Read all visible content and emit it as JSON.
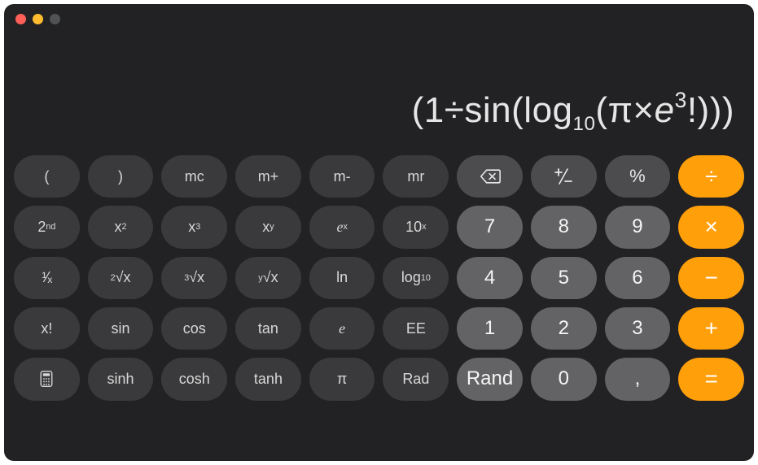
{
  "display": {
    "expression_html": "(1÷sin(log<sub>10</sub>(π×<span class='ital'>e</span><span class='sup'>3</span>!)))"
  },
  "rows": [
    [
      {
        "id": "lparen",
        "label": "(",
        "cls": "btn-sci"
      },
      {
        "id": "rparen",
        "label": ")",
        "cls": "btn-sci"
      },
      {
        "id": "mc",
        "label": "mc",
        "cls": "btn-sci"
      },
      {
        "id": "mplus",
        "label": "m+",
        "cls": "btn-sci"
      },
      {
        "id": "mminus",
        "label": "m-",
        "cls": "btn-sci"
      },
      {
        "id": "mr",
        "label": "mr",
        "cls": "btn-sci"
      },
      {
        "id": "delete",
        "label": "__DELETE__",
        "cls": "btn-func"
      },
      {
        "id": "plusminus",
        "label": "__PLUSMINUS__",
        "cls": "btn-func"
      },
      {
        "id": "percent",
        "label": "%",
        "cls": "btn-func"
      },
      {
        "id": "divide",
        "label": "÷",
        "cls": "btn-op"
      }
    ],
    [
      {
        "id": "second",
        "label": "2<sup>nd</sup>",
        "cls": "btn-sci"
      },
      {
        "id": "x-squared",
        "label": "x<sup>2</sup>",
        "cls": "btn-sci"
      },
      {
        "id": "x-cubed",
        "label": "x<sup>3</sup>",
        "cls": "btn-sci"
      },
      {
        "id": "x-power-y",
        "label": "x<sup>y</sup>",
        "cls": "btn-sci"
      },
      {
        "id": "e-power-x",
        "label": "<span class='ital'>e</span><sup>x</sup>",
        "cls": "btn-sci"
      },
      {
        "id": "ten-power-x",
        "label": "10<sup>x</sup>",
        "cls": "btn-sci"
      },
      {
        "id": "seven",
        "label": "7",
        "cls": "btn-num"
      },
      {
        "id": "eight",
        "label": "8",
        "cls": "btn-num"
      },
      {
        "id": "nine",
        "label": "9",
        "cls": "btn-num"
      },
      {
        "id": "multiply",
        "label": "×",
        "cls": "btn-op"
      }
    ],
    [
      {
        "id": "reciprocal",
        "label": "<span class='slash'>¹⁄ₓ</span>",
        "cls": "btn-sci"
      },
      {
        "id": "sqrt",
        "label": "<sup>2</sup>√x",
        "cls": "btn-sci"
      },
      {
        "id": "cbrt",
        "label": "<sup>3</sup>√x",
        "cls": "btn-sci"
      },
      {
        "id": "yroot",
        "label": "<sup>y</sup>√x",
        "cls": "btn-sci"
      },
      {
        "id": "ln",
        "label": "ln",
        "cls": "btn-sci"
      },
      {
        "id": "log10",
        "label": "log<sub>10</sub>",
        "cls": "btn-sci"
      },
      {
        "id": "four",
        "label": "4",
        "cls": "btn-num"
      },
      {
        "id": "five",
        "label": "5",
        "cls": "btn-num"
      },
      {
        "id": "six",
        "label": "6",
        "cls": "btn-num"
      },
      {
        "id": "subtract",
        "label": "−",
        "cls": "btn-op"
      }
    ],
    [
      {
        "id": "factorial",
        "label": "x!",
        "cls": "btn-sci"
      },
      {
        "id": "sin",
        "label": "sin",
        "cls": "btn-sci"
      },
      {
        "id": "cos",
        "label": "cos",
        "cls": "btn-sci"
      },
      {
        "id": "tan",
        "label": "tan",
        "cls": "btn-sci"
      },
      {
        "id": "e-constant",
        "label": "<span class='ital'>e</span>",
        "cls": "btn-sci"
      },
      {
        "id": "ee",
        "label": "EE",
        "cls": "btn-sci"
      },
      {
        "id": "one",
        "label": "1",
        "cls": "btn-num"
      },
      {
        "id": "two",
        "label": "2",
        "cls": "btn-num"
      },
      {
        "id": "three",
        "label": "3",
        "cls": "btn-num"
      },
      {
        "id": "add",
        "label": "+",
        "cls": "btn-op"
      }
    ],
    [
      {
        "id": "mode",
        "label": "__CALC__",
        "cls": "btn-sci"
      },
      {
        "id": "sinh",
        "label": "sinh",
        "cls": "btn-sci"
      },
      {
        "id": "cosh",
        "label": "cosh",
        "cls": "btn-sci"
      },
      {
        "id": "tanh",
        "label": "tanh",
        "cls": "btn-sci"
      },
      {
        "id": "pi",
        "label": "π",
        "cls": "btn-sci"
      },
      {
        "id": "rad",
        "label": "Rad",
        "cls": "btn-sci"
      },
      {
        "id": "rand",
        "label": "Rand",
        "cls": "btn-num"
      },
      {
        "id": "zero",
        "label": "0",
        "cls": "btn-num"
      },
      {
        "id": "comma",
        "label": ",",
        "cls": "btn-num"
      },
      {
        "id": "equals",
        "label": "=",
        "cls": "btn-op"
      }
    ]
  ]
}
